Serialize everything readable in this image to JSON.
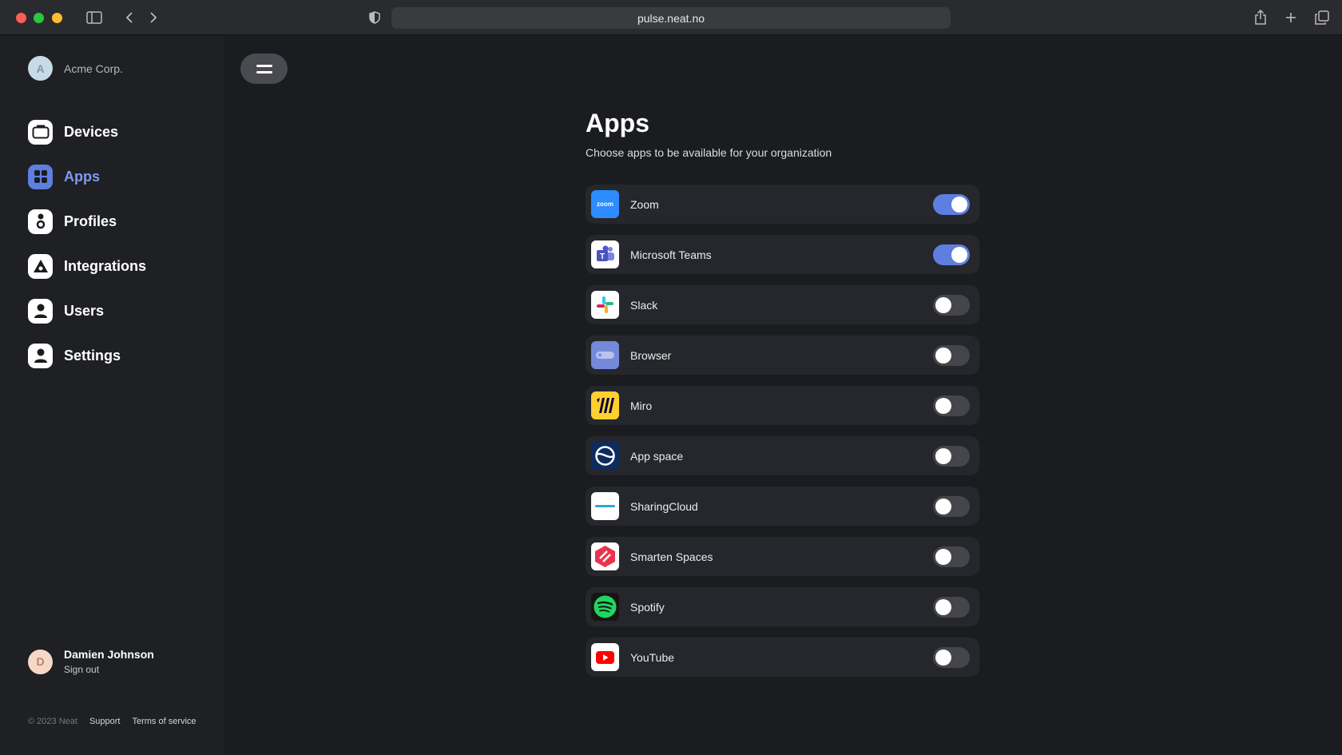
{
  "browser": {
    "url": "pulse.neat.no",
    "icons": [
      "sidebar-toggle-icon",
      "back-arrow-icon",
      "forward-arrow-icon",
      "privacy-shield-icon",
      "share-icon",
      "new-tab-plus-icon",
      "tabs-overview-icon"
    ]
  },
  "sidebar": {
    "org": {
      "initial": "A",
      "name": "Acme Corp."
    },
    "nav": [
      {
        "label": "Devices",
        "icon": "device-screen-icon",
        "active": false
      },
      {
        "label": "Apps",
        "icon": "apps-grid-icon",
        "active": true
      },
      {
        "label": "Profiles",
        "icon": "profiles-icon",
        "active": false
      },
      {
        "label": "Integrations",
        "icon": "integrations-triangle-icon",
        "active": false
      },
      {
        "label": "Users",
        "icon": "user-icon",
        "active": false
      },
      {
        "label": "Settings",
        "icon": "settings-user-icon",
        "active": false
      }
    ],
    "user": {
      "initial": "D",
      "name": "Damien Johnson",
      "signout": "Sign out"
    },
    "footer": {
      "copyright": "© 2023 Neat",
      "support": "Support",
      "terms": "Terms of service"
    }
  },
  "main": {
    "title": "Apps",
    "subtitle": "Choose apps to be available for your organization",
    "apps": [
      {
        "name": "Zoom",
        "icon": "zoom-logo-icon",
        "enabled": true
      },
      {
        "name": "Microsoft Teams",
        "icon": "microsoft-teams-logo-icon",
        "enabled": true
      },
      {
        "name": "Slack",
        "icon": "slack-logo-icon",
        "enabled": false
      },
      {
        "name": "Browser",
        "icon": "browser-icon",
        "enabled": false
      },
      {
        "name": "Miro",
        "icon": "miro-logo-icon",
        "enabled": false
      },
      {
        "name": "App space",
        "icon": "app-space-logo-icon",
        "enabled": false
      },
      {
        "name": "SharingCloud",
        "icon": "sharingcloud-logo-icon",
        "enabled": false
      },
      {
        "name": "Smarten Spaces",
        "icon": "smarten-spaces-logo-icon",
        "enabled": false
      },
      {
        "name": "Spotify",
        "icon": "spotify-logo-icon",
        "enabled": false
      },
      {
        "name": "YouTube",
        "icon": "youtube-logo-icon",
        "enabled": false
      }
    ]
  },
  "colors": {
    "accent": "#5e7fe0",
    "background": "#1b1c20",
    "sidebar": "#1f2024",
    "row": "#26272c"
  }
}
